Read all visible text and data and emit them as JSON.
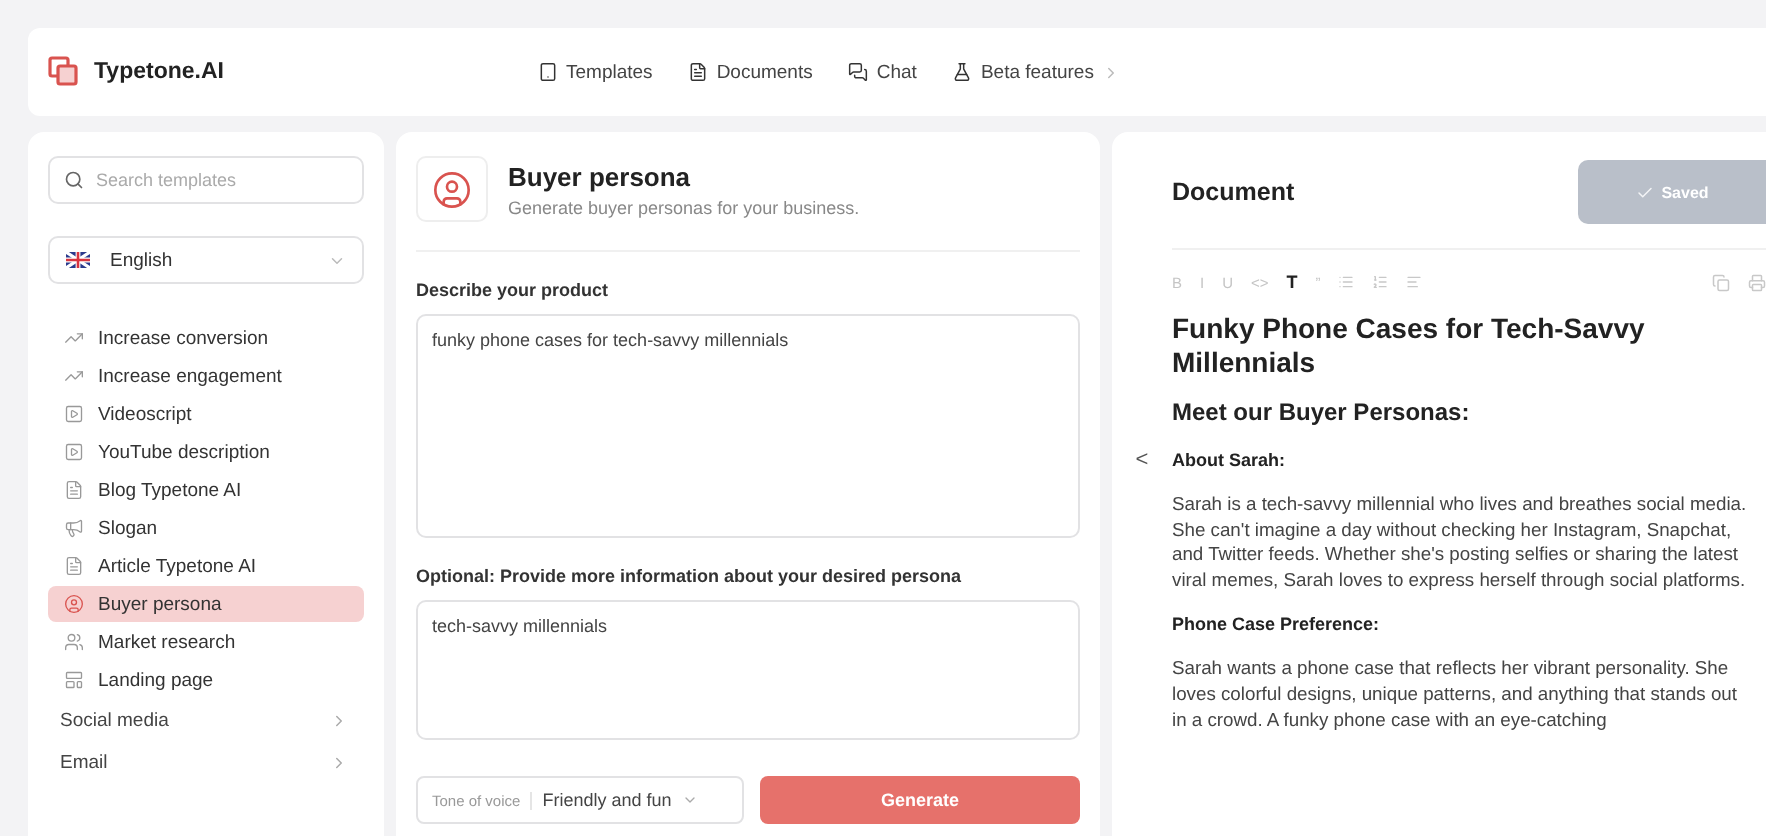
{
  "header": {
    "brand": "Typetone.AI",
    "nav": [
      {
        "label": "Templates",
        "kind": "tablet"
      },
      {
        "label": "Documents",
        "kind": "file"
      },
      {
        "label": "Chat",
        "kind": "chat"
      },
      {
        "label": "Beta features",
        "kind": "flask",
        "chevron": true
      }
    ]
  },
  "sidebar": {
    "search": {
      "placeholder": "Search templates"
    },
    "language": "English",
    "items": [
      {
        "label": "Increase conversion",
        "kind": "chart",
        "selected": false
      },
      {
        "label": "Increase engagement",
        "kind": "chart",
        "selected": false
      },
      {
        "label": "Videoscript",
        "kind": "video",
        "selected": false
      },
      {
        "label": "YouTube description",
        "kind": "video",
        "selected": false
      },
      {
        "label": "Blog Typetone AI",
        "kind": "file",
        "selected": false
      },
      {
        "label": "Slogan",
        "kind": "megaphone",
        "selected": false
      },
      {
        "label": "Article Typetone AI",
        "kind": "file",
        "selected": false
      },
      {
        "label": "Buyer persona",
        "kind": "user",
        "selected": true
      },
      {
        "label": "Market research",
        "kind": "users",
        "selected": false
      },
      {
        "label": "Landing page",
        "kind": "layout",
        "selected": false
      }
    ],
    "categories": [
      "Social media",
      "Email"
    ]
  },
  "form": {
    "title": "Buyer persona",
    "subtitle": "Generate buyer personas for your business.",
    "fields": [
      {
        "label": "Describe your product",
        "value": "funky phone cases for tech-savvy millennials"
      },
      {
        "label": "Optional: Provide more information about your desired persona",
        "value": "tech-savvy millennials"
      }
    ],
    "tone_label": "Tone of voice",
    "tone_value": "Friendly and fun",
    "generate": "Generate"
  },
  "document": {
    "title": "Document",
    "saved": "Saved",
    "collapse": "<",
    "toolbar": [
      "B",
      "I",
      "U",
      "<>",
      "T",
      "”"
    ],
    "blocks": [
      {
        "kind": "h1",
        "text": "Funky Phone Cases for Tech-Savvy Millennials"
      },
      {
        "kind": "h2",
        "text": "Meet our Buyer Personas:"
      },
      {
        "kind": "h3",
        "text": "About Sarah:"
      },
      {
        "kind": "p",
        "text": "Sarah is a tech-savvy millennial who lives and breathes social media. She can't imagine a day without checking her Instagram, Snapchat, and Twitter feeds. Whether she's posting selfies or sharing the latest viral memes, Sarah loves to express herself through social platforms."
      },
      {
        "kind": "h3",
        "text": "Phone Case Preference:"
      },
      {
        "kind": "p",
        "text": "Sarah wants a phone case that reflects her vibrant personality. She loves colorful designs, unique patterns, and anything that stands out in a crowd. A funky phone case with an eye-catching"
      }
    ]
  }
}
